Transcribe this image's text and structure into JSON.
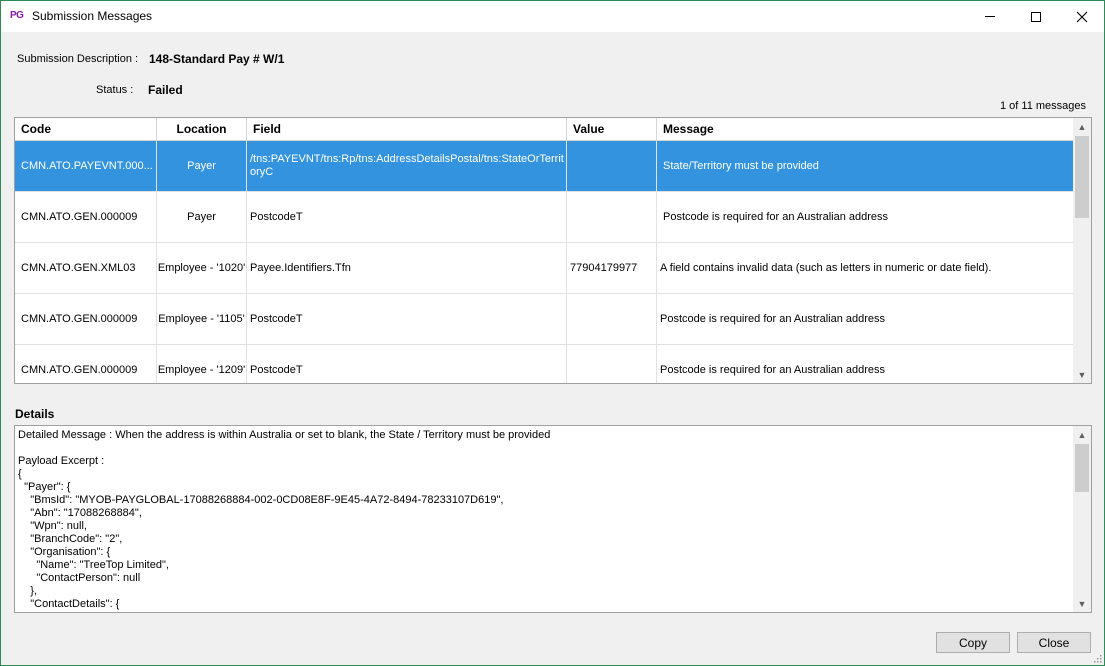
{
  "window": {
    "app_icon_text": "PG",
    "title": "Submission Messages"
  },
  "info": {
    "description_label": "Submission Description :",
    "description_value": "148-Standard Pay # W/1",
    "status_label": "Status :",
    "status_value": "Failed",
    "message_count": "1 of 11 messages"
  },
  "grid": {
    "columns": [
      "Code",
      "Location",
      "Field",
      "Value",
      "Message"
    ],
    "rows": [
      {
        "code": "CMN.ATO.PAYEVNT.000...",
        "location": "Payer",
        "field": "/tns:PAYEVNT/tns:Rp/tns:AddressDetailsPostal/tns:StateOrTerritoryC",
        "value": "",
        "message": "State/Territory must be provided",
        "selected": true
      },
      {
        "code": "CMN.ATO.GEN.000009",
        "location": "Payer",
        "field": "PostcodeT",
        "value": "",
        "message": "Postcode is required for an Australian address"
      },
      {
        "code": "CMN.ATO.GEN.XML03",
        "location": "Employee - '1020'",
        "field": "Payee.Identifiers.Tfn",
        "value": "77904179977",
        "message": "A field contains invalid data (such as letters in numeric or date field)."
      },
      {
        "code": "CMN.ATO.GEN.000009",
        "location": "Employee - '1105'",
        "field": "PostcodeT",
        "value": "",
        "message": "Postcode is required for an Australian address"
      },
      {
        "code": "CMN.ATO.GEN.000009",
        "location": "Employee - '1209'",
        "field": "PostcodeT",
        "value": "",
        "message": "Postcode is required for an Australian address"
      }
    ]
  },
  "details": {
    "label": "Details",
    "text": "Detailed Message : When the address is within Australia or set to blank, the State / Territory must be provided\n\nPayload Excerpt :\n{\n  \"Payer\": {\n    \"BmsId\": \"MYOB-PAYGLOBAL-17088268884-002-0CD08E8F-9E45-4A72-8494-78233107D619\",\n    \"Abn\": \"17088268884\",\n    \"Wpn\": null,\n    \"BranchCode\": \"2\",\n    \"Organisation\": {\n      \"Name\": \"TreeTop Limited\",\n      \"ContactPerson\": null\n    },\n    \"ContactDetails\": {"
  },
  "buttons": {
    "copy": "Copy",
    "close": "Close"
  },
  "colors": {
    "selection": "#3393df",
    "window_border": "#2e8b57",
    "app_icon": "#8b1aa8"
  }
}
